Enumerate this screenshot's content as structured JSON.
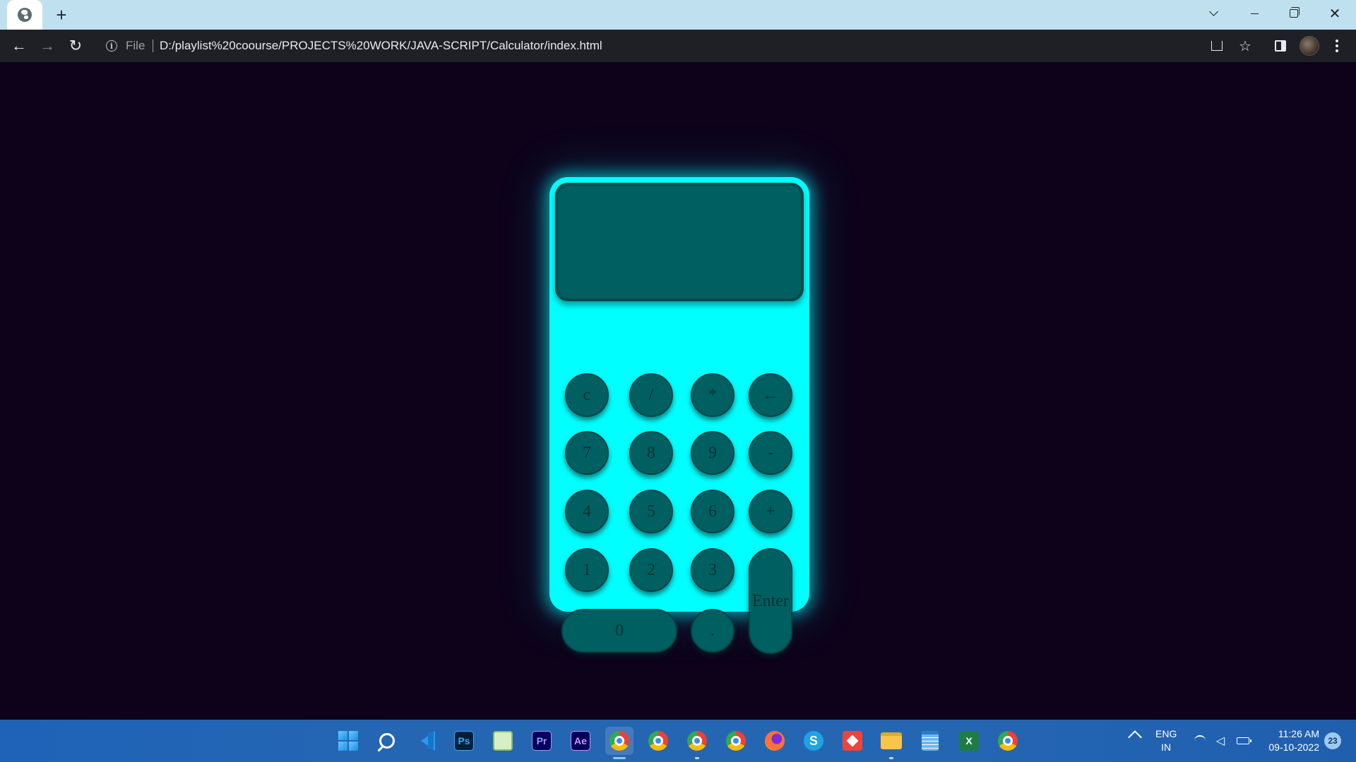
{
  "browser": {
    "new_tab_glyph": "+",
    "file_label": "File",
    "url": "D:/playlist%20coourse/PROJECTS%20WORK/JAVA-SCRIPT/Calculator/index.html"
  },
  "calculator": {
    "display_value": "",
    "keys": {
      "clear": "c",
      "divide": "/",
      "multiply": "*",
      "backspace": "←",
      "seven": "7",
      "eight": "8",
      "nine": "9",
      "minus": "-",
      "four": "4",
      "five": "5",
      "six": "6",
      "plus": "+",
      "one": "1",
      "two": "2",
      "three": "3",
      "enter": "Enter",
      "zero": "0",
      "decimal": "."
    },
    "colors": {
      "background": "#0d021a",
      "body": "#00ffff",
      "key": "#005f60"
    }
  },
  "taskbar": {
    "apps": [
      "start",
      "search",
      "visual-studio-code",
      "photoshop",
      "paint",
      "premiere-pro",
      "after-effects",
      "chrome",
      "chrome",
      "chrome",
      "chrome",
      "firefox",
      "skype",
      "anydesk",
      "file-explorer",
      "notepad",
      "excel",
      "chrome"
    ],
    "ps_label": "Ps",
    "pr_label": "Pr",
    "ae_label": "Ae",
    "skype_label": "S",
    "excel_label": "X",
    "lang_line1": "ENG",
    "lang_line2": "IN",
    "time": "11:26 AM",
    "date": "09-10-2022",
    "notifications": "23"
  }
}
